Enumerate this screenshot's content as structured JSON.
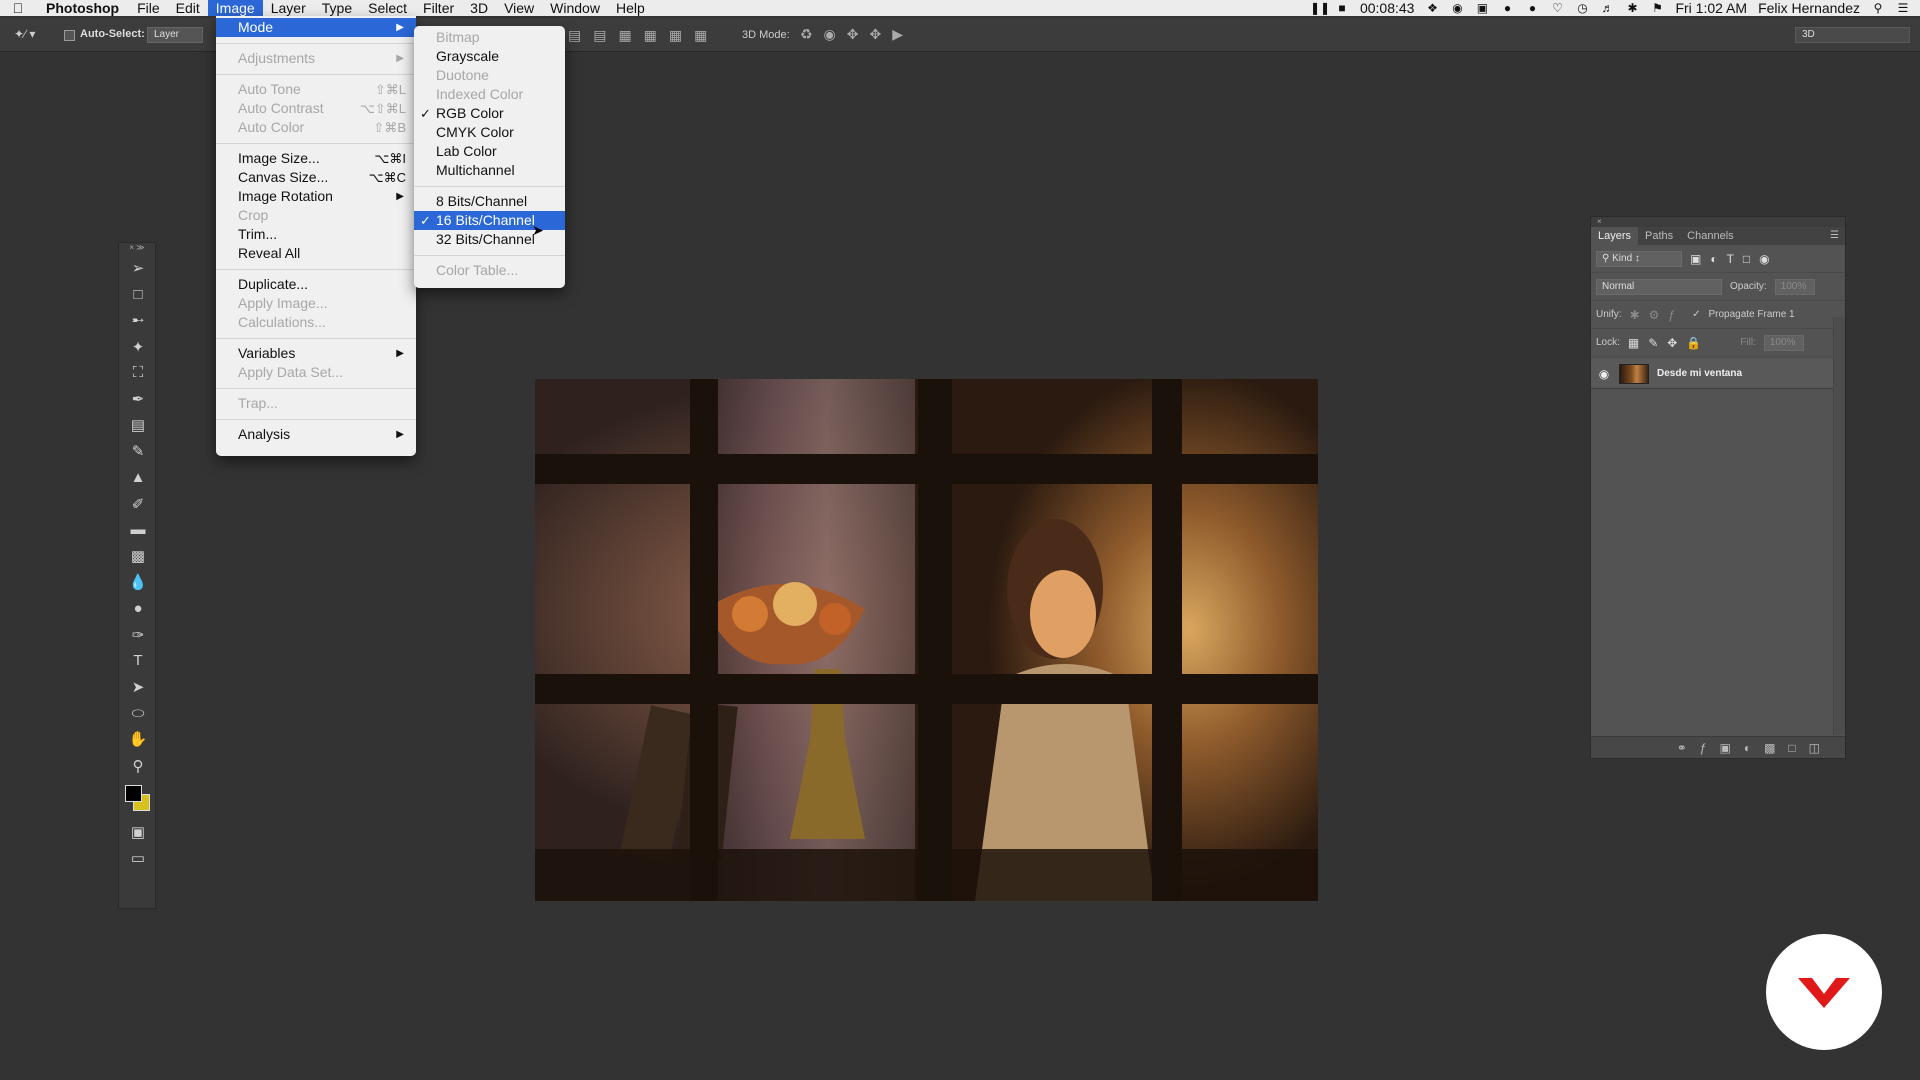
{
  "menubar": {
    "app_name": "Photoshop",
    "items": [
      "File",
      "Edit",
      "Image",
      "Layer",
      "Type",
      "Select",
      "Filter",
      "3D",
      "View",
      "Window",
      "Help"
    ],
    "active_item": "Image",
    "status": {
      "timer": "00:08:43",
      "clock": "Fri 1:02 AM",
      "user": "Felix Hernandez"
    }
  },
  "options_bar": {
    "auto_select_label": "Auto-Select:",
    "auto_select_target": "Layer",
    "mode3d_label": "3D Mode:",
    "workspace": "3D"
  },
  "image_menu": {
    "items": [
      {
        "label": "Mode",
        "submenu": true,
        "highlighted": true
      },
      {
        "separator": true
      },
      {
        "label": "Adjustments",
        "submenu": true,
        "disabled": true
      },
      {
        "separator": true
      },
      {
        "label": "Auto Tone",
        "shortcut": "⇧⌘L",
        "disabled": true
      },
      {
        "label": "Auto Contrast",
        "shortcut": "⌥⇧⌘L",
        "disabled": true
      },
      {
        "label": "Auto Color",
        "shortcut": "⇧⌘B",
        "disabled": true
      },
      {
        "separator": true
      },
      {
        "label": "Image Size...",
        "shortcut": "⌥⌘I"
      },
      {
        "label": "Canvas Size...",
        "shortcut": "⌥⌘C"
      },
      {
        "label": "Image Rotation",
        "submenu": true
      },
      {
        "label": "Crop",
        "disabled": true
      },
      {
        "label": "Trim..."
      },
      {
        "label": "Reveal All"
      },
      {
        "separator": true
      },
      {
        "label": "Duplicate..."
      },
      {
        "label": "Apply Image...",
        "disabled": true
      },
      {
        "label": "Calculations...",
        "disabled": true
      },
      {
        "separator": true
      },
      {
        "label": "Variables",
        "submenu": true
      },
      {
        "label": "Apply Data Set...",
        "disabled": true
      },
      {
        "separator": true
      },
      {
        "label": "Trap...",
        "disabled": true
      },
      {
        "separator": true
      },
      {
        "label": "Analysis",
        "submenu": true
      }
    ]
  },
  "mode_submenu": {
    "items": [
      {
        "label": "Bitmap",
        "disabled": true
      },
      {
        "label": "Grayscale"
      },
      {
        "label": "Duotone",
        "disabled": true
      },
      {
        "label": "Indexed Color",
        "disabled": true
      },
      {
        "label": "RGB Color",
        "checked": true
      },
      {
        "label": "CMYK Color"
      },
      {
        "label": "Lab Color"
      },
      {
        "label": "Multichannel"
      },
      {
        "separator": true
      },
      {
        "label": "8 Bits/Channel"
      },
      {
        "label": "16 Bits/Channel",
        "checked": true,
        "highlighted": true
      },
      {
        "label": "32 Bits/Channel"
      },
      {
        "separator": true
      },
      {
        "label": "Color Table...",
        "disabled": true
      }
    ]
  },
  "toolbox": {
    "tools": [
      "move-tool",
      "marquee-tool",
      "lasso-tool",
      "magic-wand-tool",
      "crop-tool",
      "eyedropper-tool",
      "healing-brush-tool",
      "brush-tool",
      "clone-stamp-tool",
      "history-brush-tool",
      "eraser-tool",
      "gradient-tool",
      "blur-tool",
      "dodge-tool",
      "pen-tool",
      "type-tool",
      "path-selection-tool",
      "ellipse-tool",
      "hand-tool",
      "zoom-tool"
    ],
    "foreground_color": "#000000",
    "background_color": "#d8c11c"
  },
  "layers_panel": {
    "tabs": [
      "Layers",
      "Paths",
      "Channels"
    ],
    "active_tab": "Layers",
    "filter_kind": "Kind",
    "blend_mode": "Normal",
    "opacity_label": "Opacity:",
    "opacity_value": "100%",
    "unify_label": "Unify:",
    "propagate_label": "Propagate Frame 1",
    "lock_label": "Lock:",
    "fill_label": "Fill:",
    "fill_value": "100%",
    "layers": [
      {
        "name": "Desde mi ventana",
        "visible": true
      }
    ]
  },
  "colors": {
    "menu_highlight": "#2b67d6",
    "app_background": "#333333",
    "brand_red": "#e01818"
  }
}
